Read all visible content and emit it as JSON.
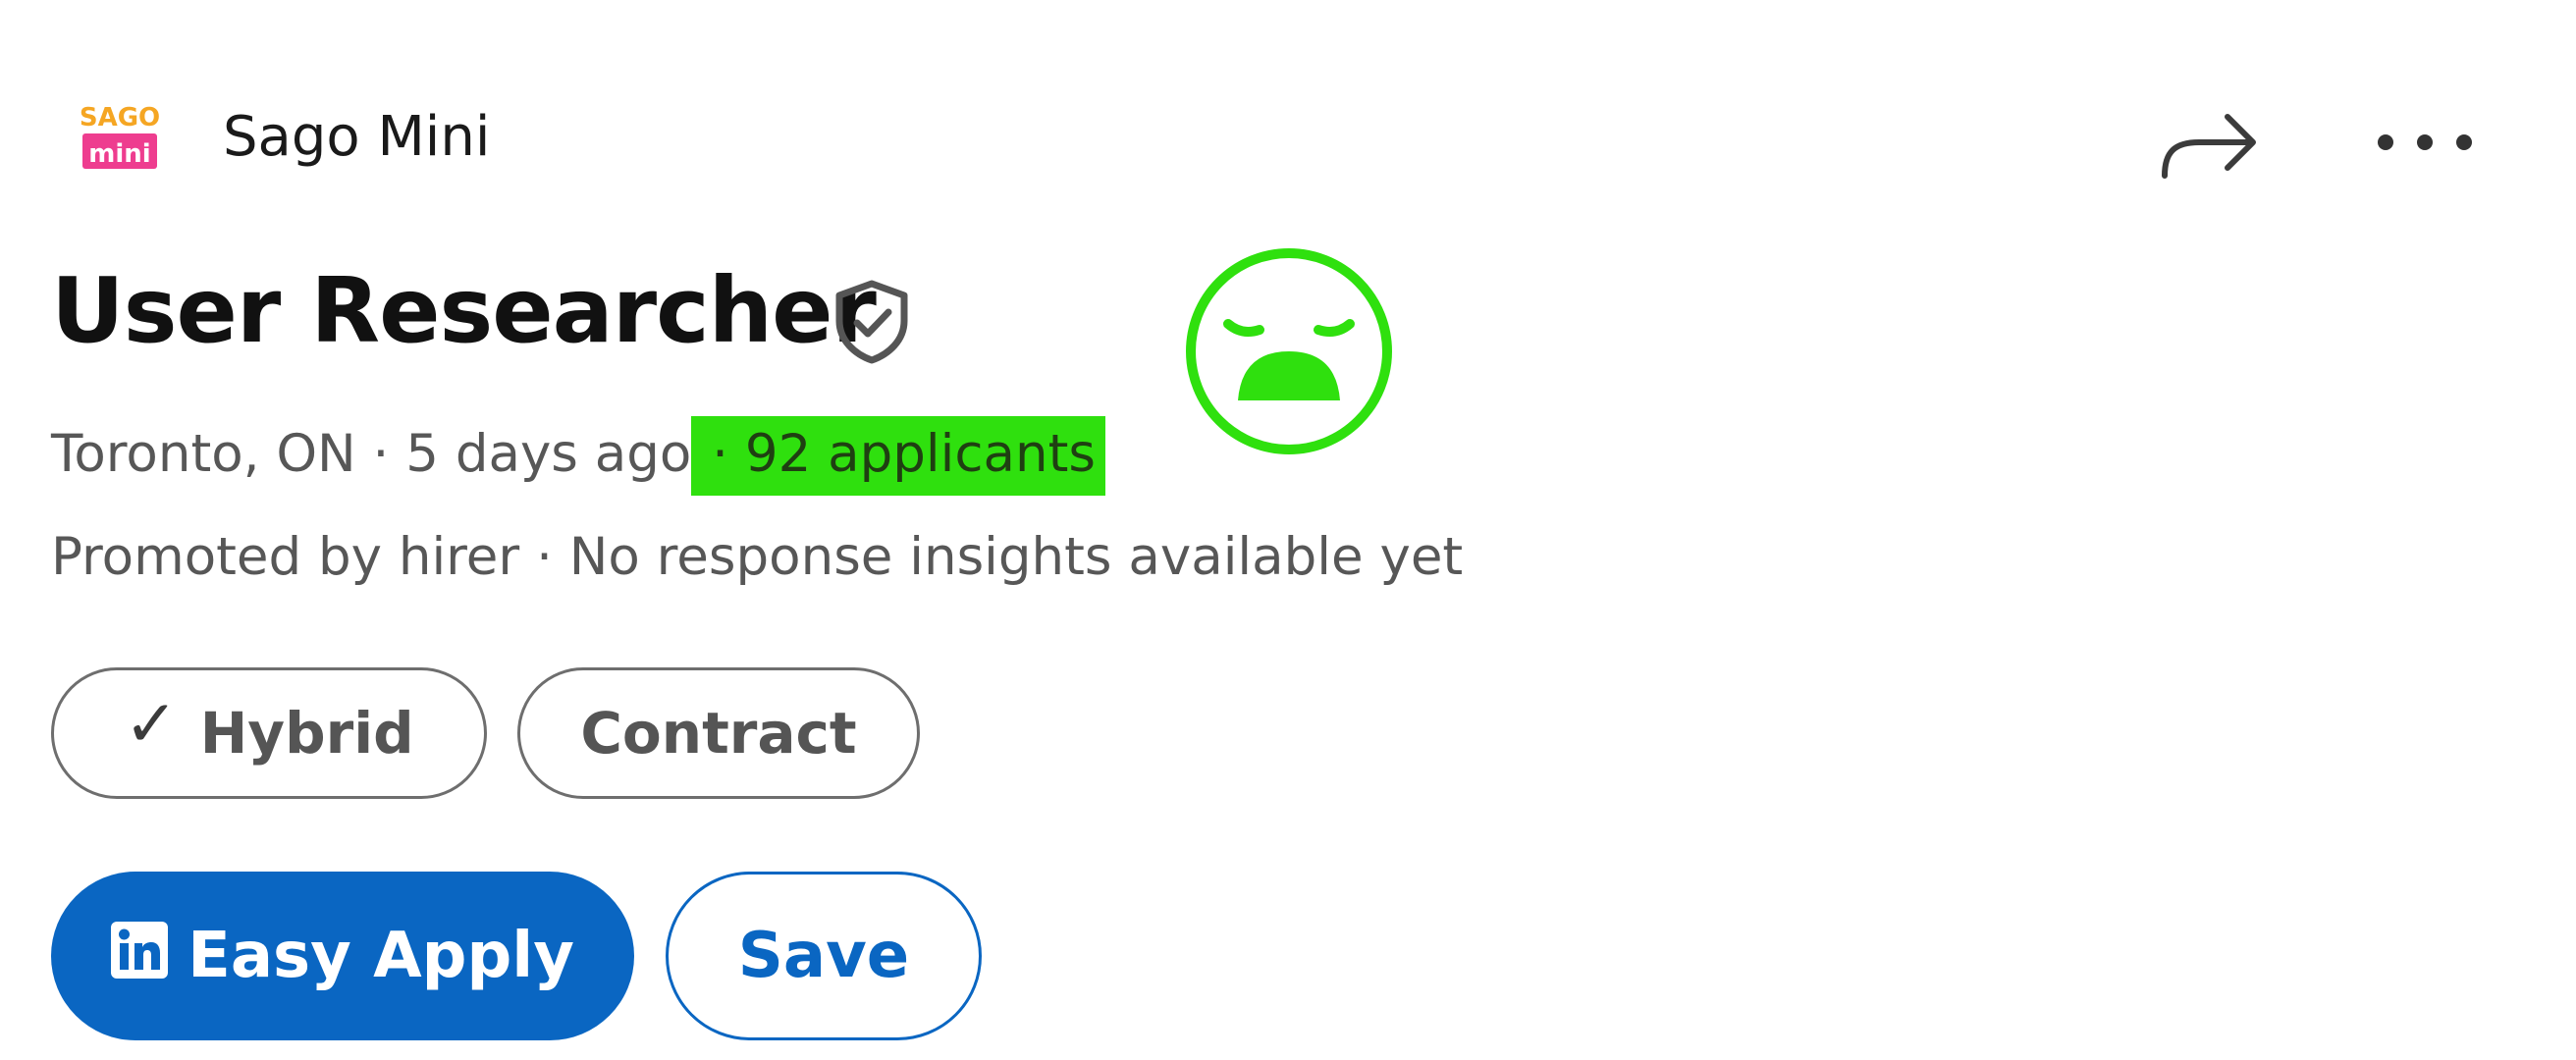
{
  "header": {
    "company_name": "Sago Mini",
    "logo_text_top": "SAGO",
    "logo_text_bottom": "mini",
    "share_icon": "share-arrow-icon",
    "more_icon": "more-options-icon"
  },
  "job": {
    "title": "User Researcher",
    "verified_icon": "verified-shield-icon",
    "location": "Toronto, ON",
    "separator": " · ",
    "posted": "5 days ago",
    "applicants": "92 applicants",
    "promoted": "Promoted by hirer",
    "response_insights": "No response insights available yet"
  },
  "pills": {
    "hybrid": "Hybrid",
    "check_glyph": "✓",
    "contract": "Contract"
  },
  "actions": {
    "easy_apply": "Easy Apply",
    "save": "Save"
  },
  "annotation": {
    "icon": "sad-face-icon",
    "color": "#2fe00e"
  },
  "colors": {
    "primary_blue": "#0a66c2",
    "highlight_green": "#2fe00e",
    "muted_text": "#575757"
  }
}
